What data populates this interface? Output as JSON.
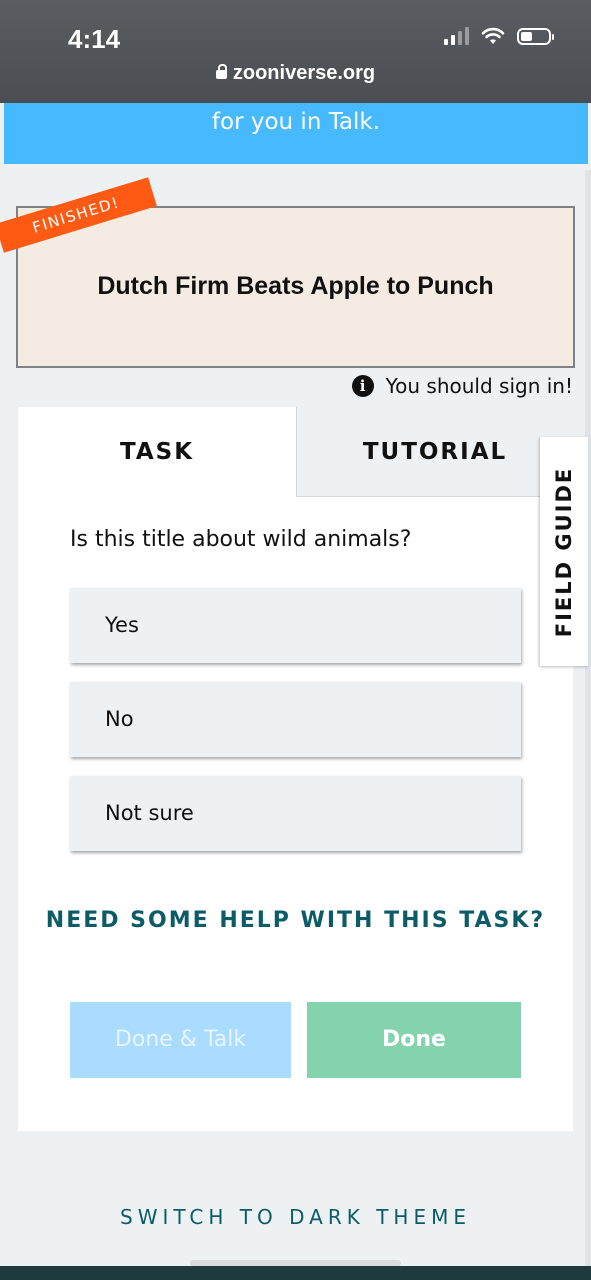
{
  "status_bar": {
    "time": "4:14",
    "url": "zooniverse.org"
  },
  "banner": {
    "text": "for you in Talk."
  },
  "subject": {
    "title": "Dutch Firm Beats Apple to Punch",
    "badge": "FINISHED!"
  },
  "signin": {
    "text": "You should sign in!"
  },
  "tabs": {
    "task": "TASK",
    "tutorial": "TUTORIAL"
  },
  "task": {
    "question": "Is this title about wild animals?",
    "answers": [
      "Yes",
      "No",
      "Not sure"
    ],
    "help": "NEED SOME HELP WITH THIS TASK?"
  },
  "buttons": {
    "done_talk": "Done & Talk",
    "done": "Done"
  },
  "field_guide": "FIELD GUIDE",
  "theme_toggle": "SWITCH TO DARK THEME",
  "colors": {
    "banner": "#46b9ff",
    "finished": "#ff5a14",
    "done": "#85d3ae",
    "done_talk": "#a9dcff",
    "teal_text": "#0b5c67"
  }
}
